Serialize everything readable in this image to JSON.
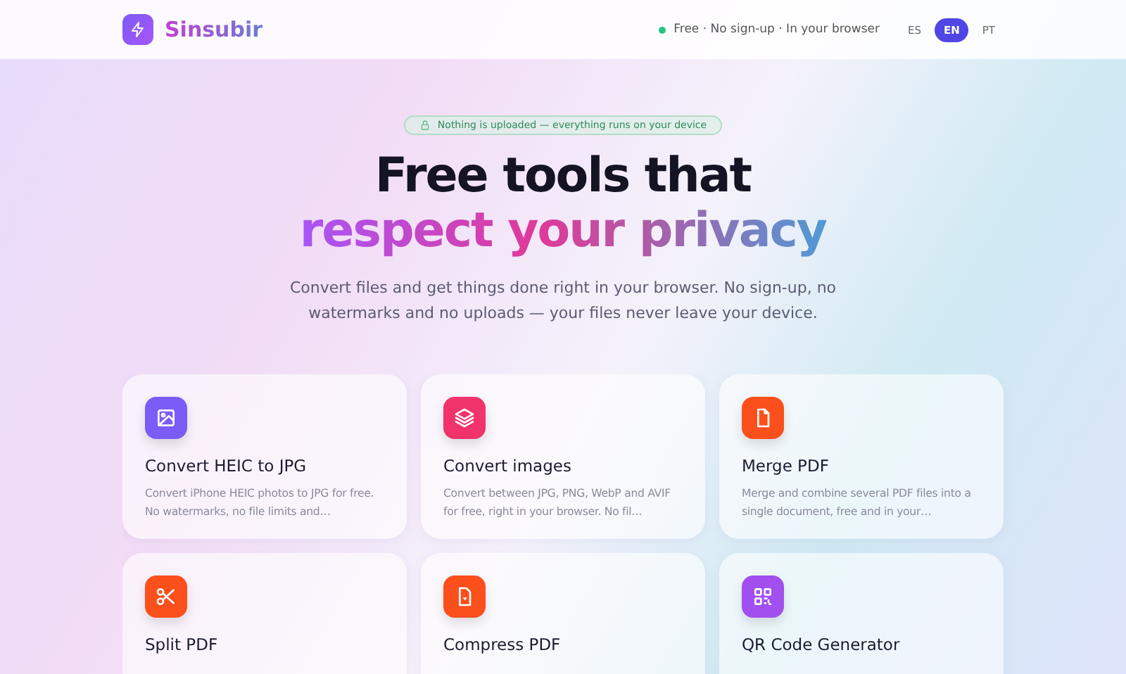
{
  "header": {
    "logo_text": "Sinsubir",
    "tagline": "Free · No sign-up · In your browser",
    "languages": [
      {
        "label": "ES",
        "selected": false
      },
      {
        "label": "EN",
        "selected": true
      },
      {
        "label": "PT",
        "selected": false
      }
    ]
  },
  "hero": {
    "badge": "Nothing is uploaded — everything runs on your device",
    "title_line1": "Free tools that",
    "title_line2": "respect your privacy",
    "subtitle": "Convert files and get things done right in your browser. No sign-up, no watermarks and no uploads — your files never leave your device."
  },
  "tools": [
    {
      "kind": "image",
      "color": "#7c5cf6",
      "title": "Convert HEIC to JPG",
      "description": "Convert iPhone HEIC photos to JPG for free. No watermarks, no file limits and…"
    },
    {
      "kind": "layers",
      "color": "#f0336b",
      "title": "Convert images",
      "description": "Convert between JPG, PNG, WebP and AVIF for free, right in your browser. No fil…"
    },
    {
      "kind": "file",
      "color": "#fb4f1c",
      "title": "Merge PDF",
      "description": "Merge and combine several PDF files into a single document, free and in your…"
    },
    {
      "kind": "scissors",
      "color": "#fb4f1c",
      "title": "Split PDF"
    },
    {
      "kind": "compress",
      "color": "#fb4f1c",
      "title": "Compress PDF"
    },
    {
      "kind": "qr",
      "color": "#a24ff0",
      "title": "QR Code Generator"
    }
  ]
}
